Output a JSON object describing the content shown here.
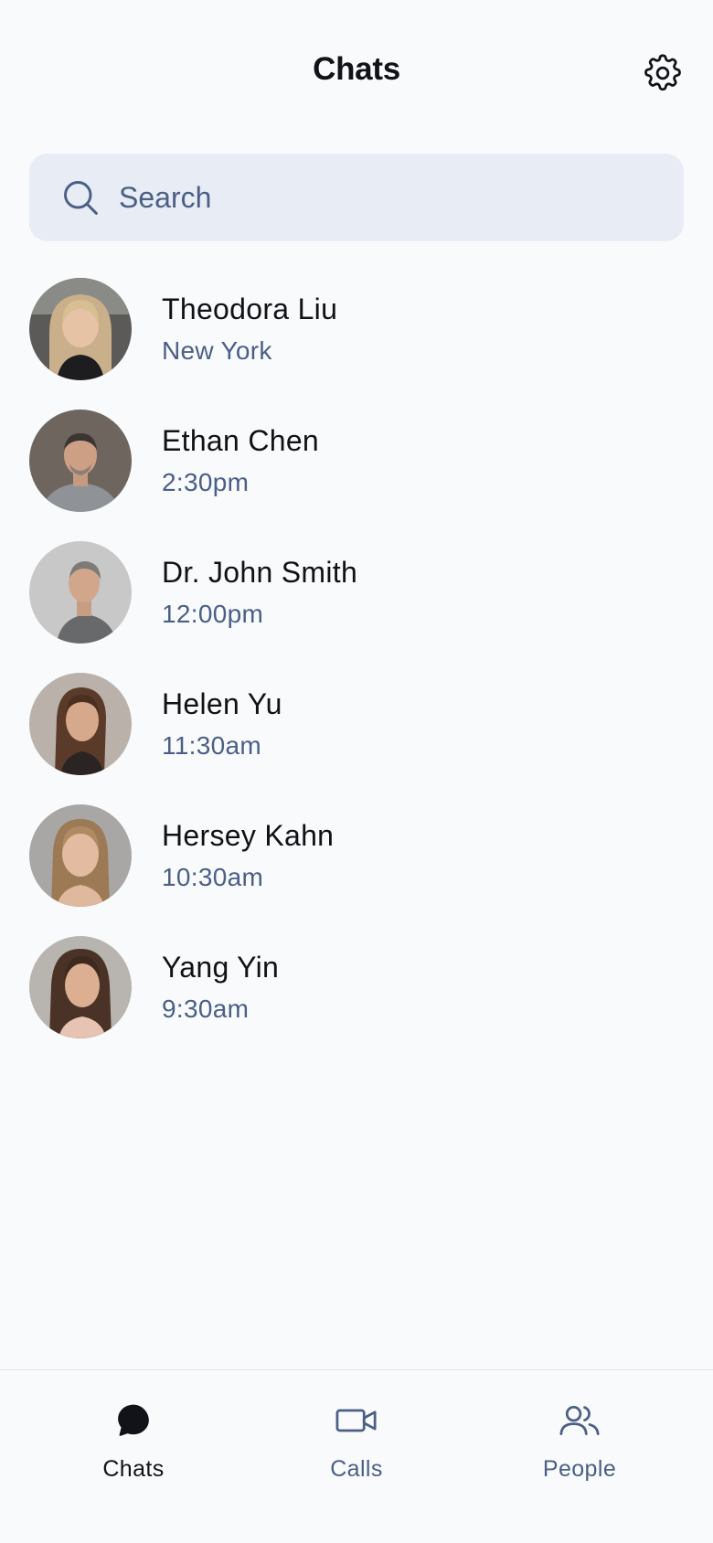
{
  "header": {
    "title": "Chats",
    "settings_icon": "gear-icon"
  },
  "search": {
    "placeholder": "Search",
    "value": "",
    "icon": "search-icon"
  },
  "chats": [
    {
      "name": "Theodora Liu",
      "subtitle": "New York"
    },
    {
      "name": "Ethan Chen",
      "subtitle": "2:30pm"
    },
    {
      "name": "Dr. John Smith",
      "subtitle": "12:00pm"
    },
    {
      "name": "Helen Yu",
      "subtitle": "11:30am"
    },
    {
      "name": "Hersey Kahn",
      "subtitle": "10:30am"
    },
    {
      "name": "Yang Yin",
      "subtitle": "9:30am"
    }
  ],
  "bottom_nav": {
    "items": [
      {
        "label": "Chats",
        "icon": "chat-bubble-icon",
        "active": true
      },
      {
        "label": "Calls",
        "icon": "video-camera-icon",
        "active": false
      },
      {
        "label": "People",
        "icon": "people-icon",
        "active": false
      }
    ]
  },
  "colors": {
    "background": "#f8fafc",
    "search_background": "#e8ecf4",
    "secondary_text": "#4b5f86",
    "primary_text": "#111318"
  }
}
